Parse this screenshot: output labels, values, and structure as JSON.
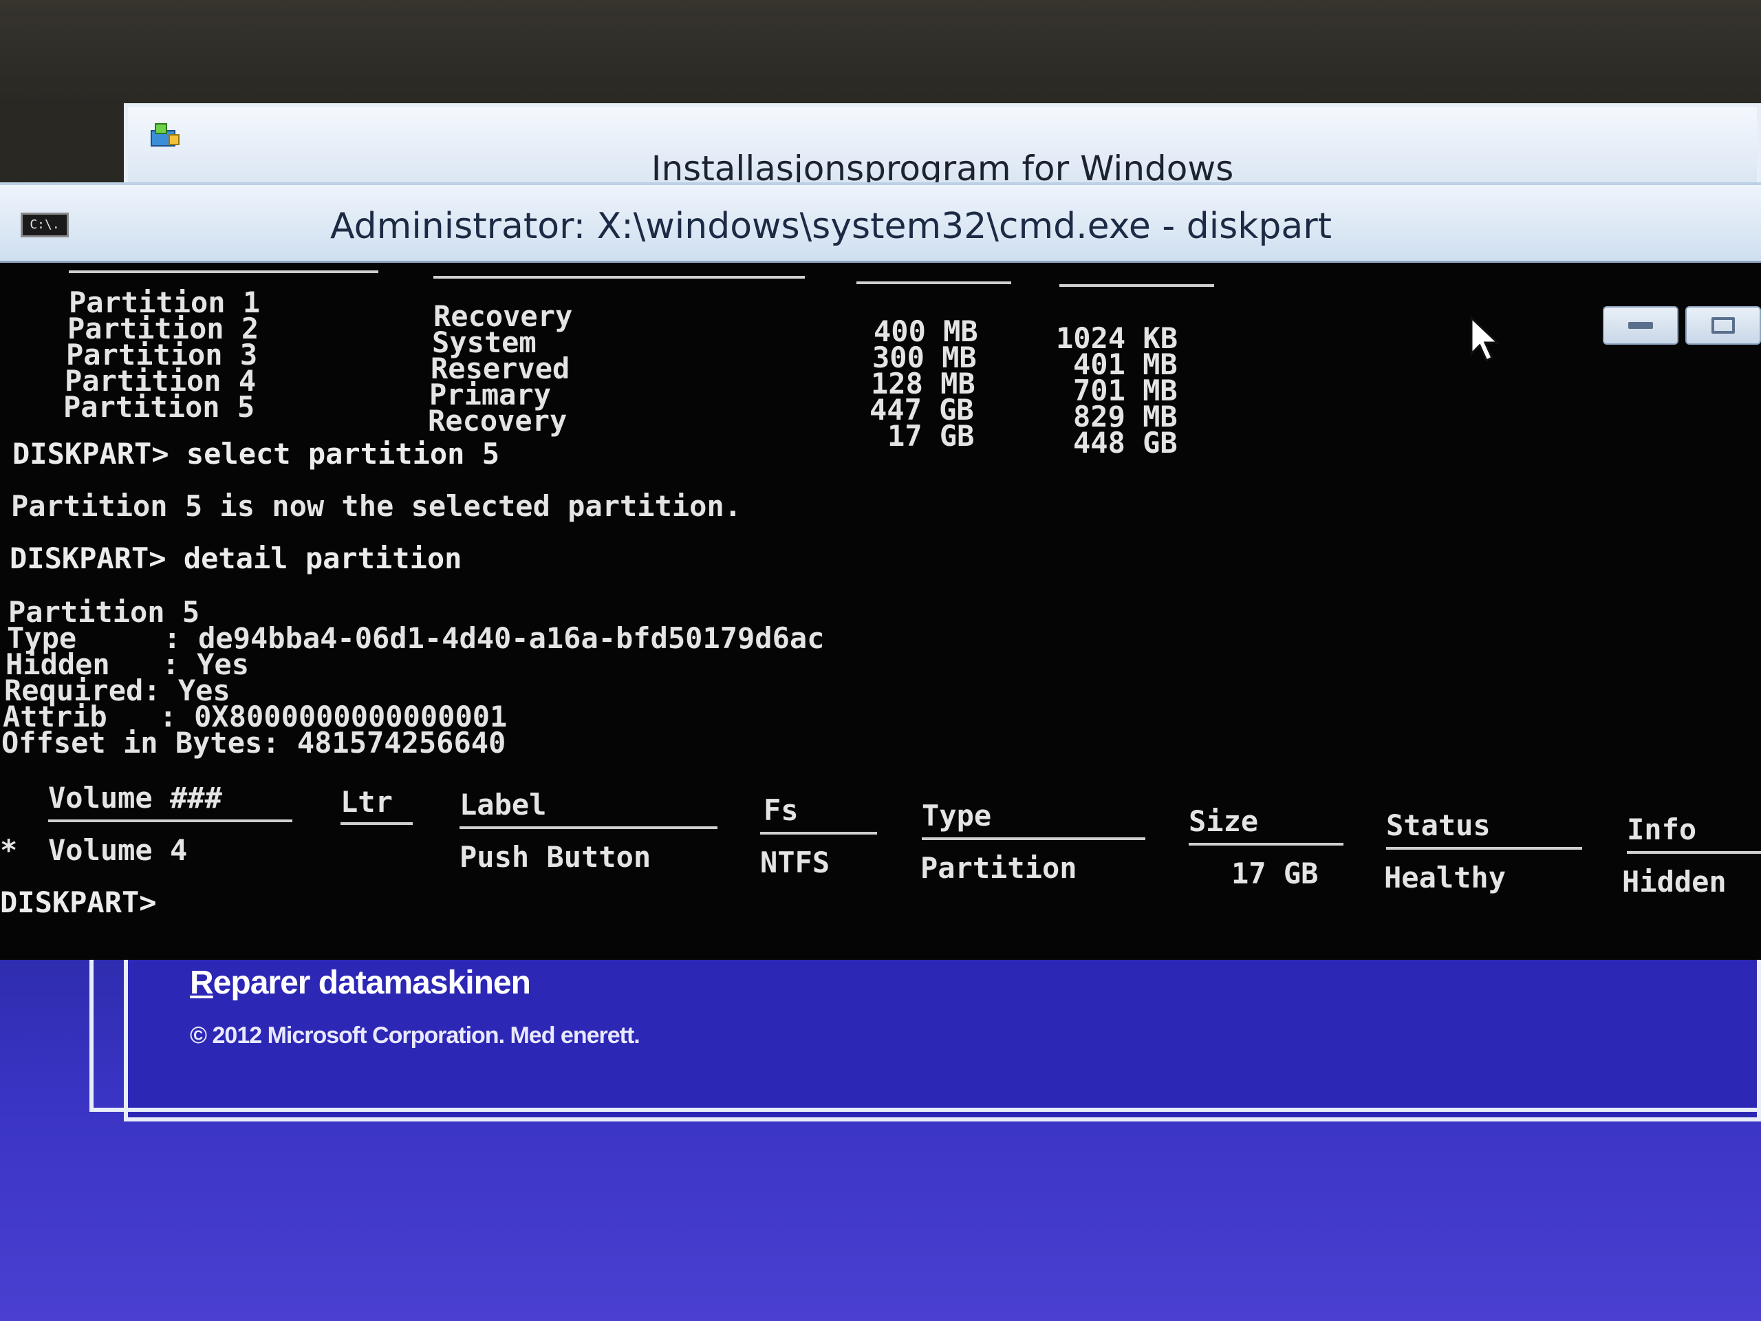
{
  "setup_window": {
    "title": "Installasjonsprogram for Windows",
    "repair_link_first": "R",
    "repair_link_rest": "eparer datamaskinen",
    "copyright": "© 2012 Microsoft Corporation. Med enerett."
  },
  "cmd_window": {
    "icon_text": "C:\\.",
    "title": "Administrator: X:\\windows\\system32\\cmd.exe - diskpart"
  },
  "partition_list": {
    "rows": [
      {
        "name": "Partition 1",
        "type": "Recovery",
        "size": "400 MB",
        "offset": "1024 KB"
      },
      {
        "name": "Partition 2",
        "type": "System",
        "size": "300 MB",
        "offset": "401 MB"
      },
      {
        "name": "Partition 3",
        "type": "Reserved",
        "size": "128 MB",
        "offset": "701 MB"
      },
      {
        "name": "Partition 4",
        "type": "Primary",
        "size": "447 GB",
        "offset": "829 MB"
      },
      {
        "name": "Partition 5",
        "type": "Recovery",
        "size": "17 GB",
        "offset": "448 GB"
      }
    ]
  },
  "session": {
    "cmd_select": "DISKPART> select partition 5",
    "select_result": "Partition 5 is now the selected partition.",
    "cmd_detail": "DISKPART> detail partition",
    "detail_header": "Partition 5",
    "type_line": "Type     : de94bba4-06d1-4d40-a16a-bfd50179d6ac",
    "hidden_line": "Hidden   : Yes",
    "required_line": "Required: Yes",
    "attrib_line": "Attrib   : 0X8000000000000001",
    "offset_line": "Offset in Bytes: 481574256640",
    "final_prompt": "DISKPART>"
  },
  "volume_table": {
    "headers": {
      "volume": "Volume ###",
      "ltr": "Ltr",
      "label": "Label",
      "fs": "Fs",
      "type": "Type",
      "size": "Size",
      "status": "Status",
      "info": "Info"
    },
    "row": {
      "marker": "*",
      "volume": "Volume 4",
      "ltr": "",
      "label": "Push Button",
      "fs": "NTFS",
      "type": "Partition",
      "size": "17 GB",
      "status": "Healthy",
      "info": "Hidden"
    }
  },
  "colors": {
    "console_bg": "#050505",
    "console_text": "#e4e4e4",
    "setup_bg": "#2d27b5",
    "titlebar": "#dbe6f3"
  }
}
